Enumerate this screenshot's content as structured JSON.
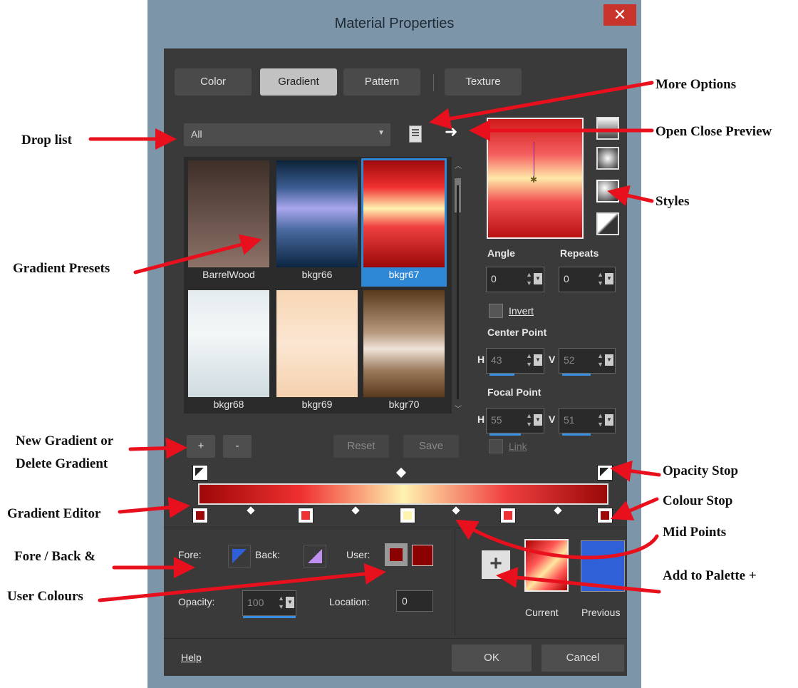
{
  "dialog": {
    "title": "Material Properties",
    "close_icon": "close-icon"
  },
  "tabs": [
    {
      "label": "Color",
      "active": false
    },
    {
      "label": "Gradient",
      "active": true
    },
    {
      "label": "Pattern",
      "active": false
    },
    {
      "label": "Texture",
      "active": false
    }
  ],
  "droplist": {
    "value": "All"
  },
  "presets": [
    {
      "name": "BarrelWood",
      "selected": false
    },
    {
      "name": "bkgr66",
      "selected": false
    },
    {
      "name": "bkgr67",
      "selected": true
    },
    {
      "name": "bkgr68",
      "selected": false
    },
    {
      "name": "bkgr69",
      "selected": false
    },
    {
      "name": "bkgr70",
      "selected": false
    }
  ],
  "preset_buttons": {
    "add": "+",
    "delete": "-",
    "reset": "Reset",
    "save": "Save"
  },
  "controls": {
    "angle_label": "Angle",
    "angle": "0",
    "repeats_label": "Repeats",
    "repeats": "0",
    "invert": "Invert",
    "center_point": "Center Point",
    "center_h": "43",
    "center_v": "52",
    "focal_point": "Focal Point",
    "focal_h": "55",
    "focal_v": "51",
    "h": "H",
    "v": "V",
    "link": "Link"
  },
  "bottom": {
    "fore": "Fore:",
    "back": "Back:",
    "user": "User:",
    "opacity_label": "Opacity:",
    "opacity": "100",
    "location_label": "Location:",
    "location": "0",
    "current": "Current",
    "previous": "Previous",
    "add_palette": "+"
  },
  "footer": {
    "help": "Help",
    "ok": "OK",
    "cancel": "Cancel"
  },
  "annotations": {
    "more_options": "More Options",
    "drop_list": "Drop list",
    "open_close_preview": "Open Close Preview",
    "styles": "Styles",
    "gradient_presets": "Gradient Presets",
    "new_gradient": "New Gradient or",
    "delete_gradient": "Delete Gradient",
    "opacity_stop": "Opacity Stop",
    "gradient_editor": "Gradient Editor",
    "colour_stop": "Colour Stop",
    "mid_points": "Mid Points",
    "fore_back": "Fore / Back &",
    "user_colours": "User Colours",
    "add_to_palette": "Add to Palette +"
  },
  "colors": {
    "accent": "#3a8ee0",
    "close": "#c8342c",
    "arrow": "#e8101c",
    "user_color": "#8b0000",
    "previous": "#3060d8"
  }
}
